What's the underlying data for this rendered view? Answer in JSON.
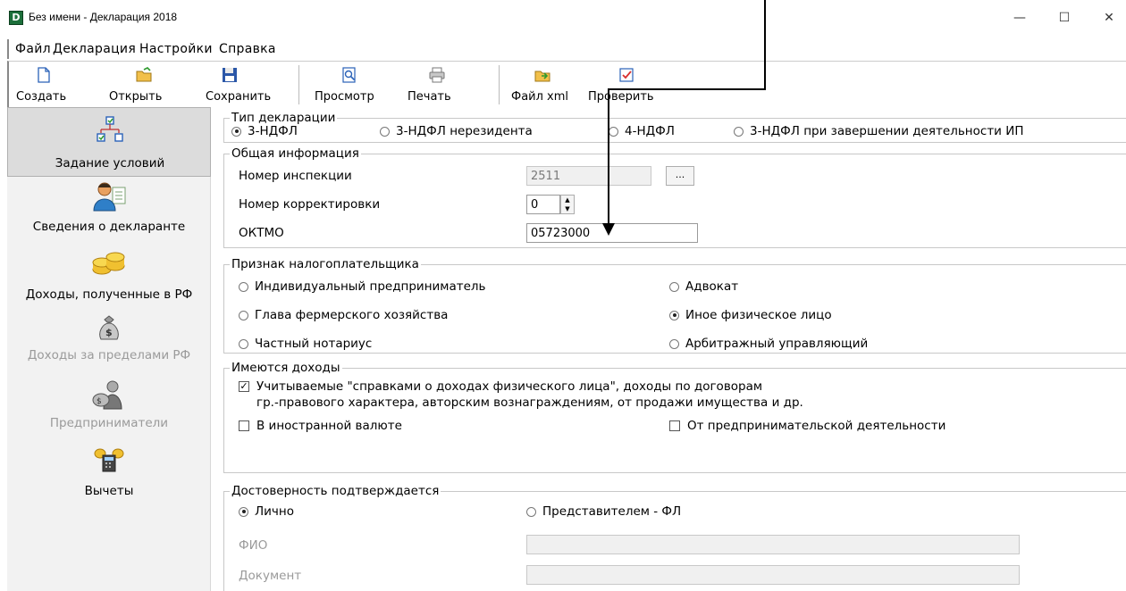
{
  "window": {
    "title": "Без имени - Декларация 2018",
    "app_icon_letter": "D",
    "minimize": "—",
    "maximize": "☐",
    "close": "✕"
  },
  "menu": [
    "Файл",
    "Декларация",
    "Настройки",
    "Справка"
  ],
  "toolbar": {
    "create": "Создать",
    "open": "Открыть",
    "save": "Сохранить",
    "preview": "Просмотр",
    "print": "Печать",
    "xml": "Файл xml",
    "check": "Проверить"
  },
  "nav": [
    {
      "label": "Задание условий",
      "active": true,
      "icon": "tree-icon"
    },
    {
      "label": "Сведения о декларанте",
      "icon": "person-icon"
    },
    {
      "label": "Доходы, полученные в РФ",
      "icon": "coins-icon"
    },
    {
      "label": "Доходы за пределами РФ",
      "disabled": true,
      "icon": "money-bag-icon"
    },
    {
      "label": "Предприниматели",
      "disabled": true,
      "icon": "businessman-icon"
    },
    {
      "label": "Вычеты",
      "icon": "calculator-icon"
    }
  ],
  "declaration_type": {
    "title": "Тип декларации",
    "options": [
      "3-НДФЛ",
      "3-НДФЛ нерезидента",
      "4-НДФЛ",
      "3-НДФЛ при завершении деятельности ИП"
    ],
    "selected": "3-НДФЛ"
  },
  "general_info": {
    "title": "Общая информация",
    "inspection_label": "Номер инспекции",
    "inspection_value": "2511",
    "browse_button": "...",
    "correction_label": "Номер корректировки",
    "correction_value": "0",
    "oktmo_label": "ОКТМО",
    "oktmo_value": "05723000"
  },
  "taxpayer_sign": {
    "title": "Признак налогоплательщика",
    "options": [
      "Индивидуальный предприниматель",
      "Адвокат",
      "Глава фермерского хозяйства",
      "Иное физическое лицо",
      "Частный нотариус",
      "Арбитражный управляющий"
    ],
    "selected": "Иное физическое лицо"
  },
  "income": {
    "title": "Имеются доходы",
    "certified_line1": "Учитываемые \"справками о доходах физического лица\", доходы по договорам",
    "certified_line2": "гр.-правового характера, авторским вознаграждениям, от продажи имущества и др.",
    "certified_checked": true,
    "foreign_currency": "В иностранной валюте",
    "foreign_currency_checked": false,
    "business": "От предпринимательской деятельности",
    "business_checked": false
  },
  "confirmation": {
    "title": "Достоверность подтверждается",
    "personally": "Лично",
    "representative": "Представителем - ФЛ",
    "selected": "Лично",
    "fio_label": "ФИО",
    "fio_value": "",
    "document_label": "Документ",
    "document_value": ""
  },
  "colors": {
    "active_nav": "#dcdcdc",
    "disabled_text": "#9a9a9a"
  }
}
